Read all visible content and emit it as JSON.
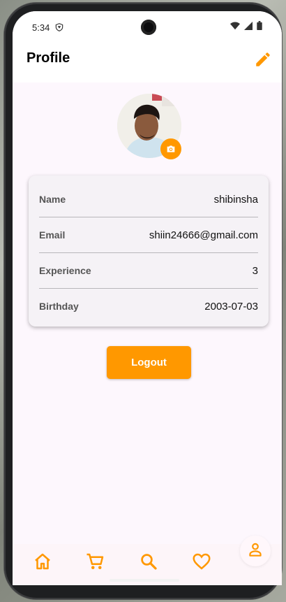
{
  "status_bar": {
    "time": "5:34"
  },
  "app_bar": {
    "title": "Profile"
  },
  "profile": {
    "rows": [
      {
        "label": "Name",
        "value": "shibinsha"
      },
      {
        "label": "Email",
        "value": "shiin24666@gmail.com"
      },
      {
        "label": "Experience",
        "value": "3"
      },
      {
        "label": "Birthday",
        "value": "2003-07-03"
      }
    ]
  },
  "logout_label": "Logout",
  "accent_color": "#ff9800",
  "bottom_nav": {
    "items": [
      {
        "icon": "home-icon"
      },
      {
        "icon": "cart-icon"
      },
      {
        "icon": "search-icon"
      },
      {
        "icon": "heart-icon"
      },
      {
        "icon": "person-icon",
        "selected": true
      }
    ]
  }
}
